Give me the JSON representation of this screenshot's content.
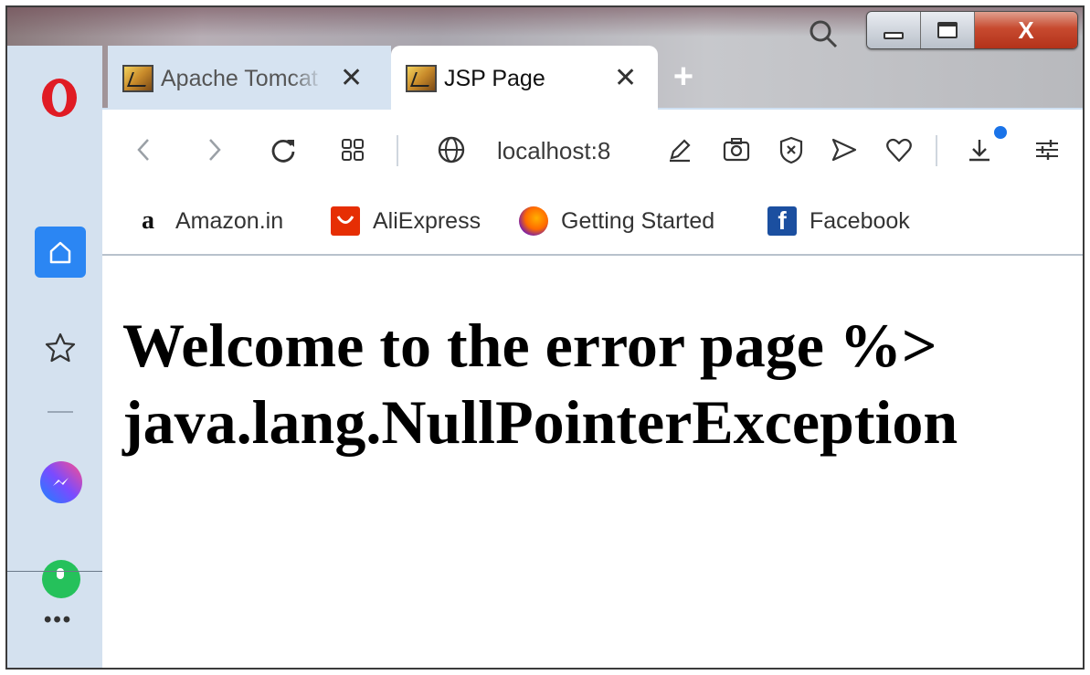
{
  "window": {
    "controls": {
      "minimize_icon": "minimize-icon",
      "maximize_icon": "maximize-icon",
      "close_label": "X"
    }
  },
  "tabs": [
    {
      "title": "Apache Tomcat",
      "favicon": "tomcat-favicon-icon",
      "active": false,
      "close_glyph": "✕"
    },
    {
      "title": "JSP Page",
      "favicon": "tomcat-favicon-icon",
      "active": true,
      "close_glyph": "✕"
    }
  ],
  "new_tab_glyph": "+",
  "toolbar": {
    "address": "localhost:8",
    "icons": [
      "back-icon",
      "forward-icon",
      "reload-icon",
      "speed-dial-icon",
      "globe-icon",
      "edit-icon",
      "snapshot-icon",
      "adblock-icon",
      "send-icon",
      "heart-icon",
      "download-icon",
      "easy-setup-icon"
    ]
  },
  "bookmarks": [
    {
      "label": "Amazon.in",
      "icon_text": "a"
    },
    {
      "label": "AliExpress",
      "icon_text": ""
    },
    {
      "label": "Getting Started",
      "icon_text": ""
    },
    {
      "label": "Facebook",
      "icon_text": "f"
    }
  ],
  "sidebar": {
    "items": [
      "opera-logo-icon",
      "home-icon",
      "star-icon",
      "messenger-icon",
      "whatsapp-icon"
    ],
    "more_label": "•••"
  },
  "page": {
    "heading_line1": "Welcome to the error page %>",
    "heading_line2": "java.lang.NullPointerException"
  },
  "colors": {
    "accent": "#2b86f3",
    "download_badge": "#1a73e8",
    "opera_red": "#e01b24"
  }
}
